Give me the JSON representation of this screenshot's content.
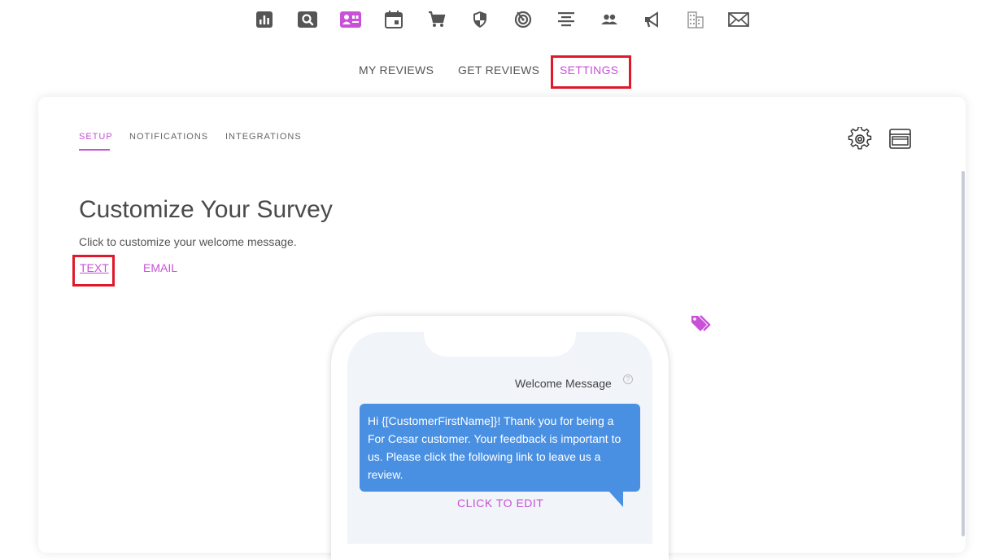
{
  "toolbar": {
    "icons": [
      "bar-chart-icon",
      "search-icon",
      "reviews-icon",
      "calendar-icon",
      "cart-icon",
      "shield-icon",
      "radar-icon",
      "align-center-icon",
      "people-icon",
      "megaphone-icon",
      "building-icon",
      "mail-icon"
    ],
    "active_icon": "reviews-icon",
    "accent": "#c851d8",
    "icon_color": "#555555"
  },
  "main_nav": {
    "items": [
      "MY REVIEWS",
      "GET REVIEWS",
      "SETTINGS"
    ],
    "active": "SETTINGS"
  },
  "sub_nav": {
    "tabs": [
      "SETUP",
      "NOTIFICATIONS",
      "INTEGRATIONS"
    ],
    "active": "SETUP"
  },
  "header_icons": [
    "gear-icon",
    "browser-window-icon"
  ],
  "page": {
    "title": "Customize Your Survey",
    "subtitle": "Click to customize your welcome message.",
    "links": [
      "TEXT",
      "EMAIL"
    ],
    "active_link": "TEXT"
  },
  "preview": {
    "welcome_label": "Welcome Message",
    "help_glyph": "?",
    "message": "Hi {[CustomerFirstName]}! Thank you for being a For Cesar customer. Your feedback is important to us. Please click the following link to leave us a review.",
    "edit_label": "CLICK TO EDIT",
    "bubble_color": "#4a90e2"
  },
  "highlight_color": "#e0192a"
}
